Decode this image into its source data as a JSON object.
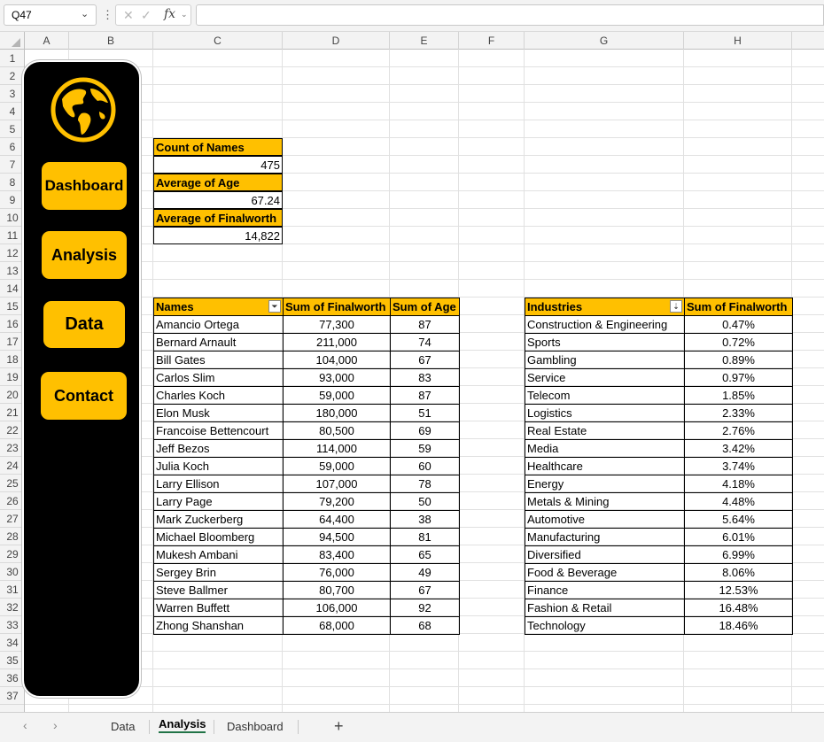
{
  "formula_bar": {
    "name_box": "Q47",
    "formula": ""
  },
  "columns": [
    "A",
    "B",
    "C",
    "D",
    "E",
    "F",
    "G",
    "H"
  ],
  "rows": [
    "1",
    "2",
    "3",
    "4",
    "5",
    "6",
    "7",
    "8",
    "9",
    "10",
    "11",
    "12",
    "13",
    "14",
    "15",
    "16",
    "17",
    "18",
    "19",
    "20",
    "21",
    "22",
    "23",
    "24",
    "25",
    "26",
    "27",
    "28",
    "29",
    "30",
    "31",
    "32",
    "33",
    "34",
    "35",
    "36",
    "37"
  ],
  "sidebar": {
    "buttons": [
      "Dashboard",
      "Analysis",
      "Data",
      "Contact"
    ],
    "colors": {
      "background": "#000000",
      "button": "#ffc000"
    }
  },
  "summary": {
    "count_label": "Count of Names",
    "count_value": "475",
    "age_label": "Average of Age",
    "age_value": "67.24",
    "worth_label": "Average of Finalworth",
    "worth_value": "14,822"
  },
  "people_table": {
    "headers": [
      "Names",
      "Sum of Finalworth",
      "Sum of Age"
    ],
    "rows": [
      [
        "Amancio Ortega",
        "77,300",
        "87"
      ],
      [
        "Bernard Arnault",
        "211,000",
        "74"
      ],
      [
        "Bill Gates",
        "104,000",
        "67"
      ],
      [
        "Carlos Slim",
        "93,000",
        "83"
      ],
      [
        "Charles Koch",
        "59,000",
        "87"
      ],
      [
        "Elon Musk",
        "180,000",
        "51"
      ],
      [
        "Francoise Bettencourt",
        "80,500",
        "69"
      ],
      [
        "Jeff Bezos",
        "114,000",
        "59"
      ],
      [
        "Julia Koch",
        "59,000",
        "60"
      ],
      [
        "Larry Ellison",
        "107,000",
        "78"
      ],
      [
        "Larry Page",
        "79,200",
        "50"
      ],
      [
        "Mark Zuckerberg",
        "64,400",
        "38"
      ],
      [
        "Michael Bloomberg",
        "94,500",
        "81"
      ],
      [
        "Mukesh Ambani",
        "83,400",
        "65"
      ],
      [
        "Sergey Brin",
        "76,000",
        "49"
      ],
      [
        "Steve Ballmer",
        "80,700",
        "67"
      ],
      [
        "Warren Buffett",
        "106,000",
        "92"
      ],
      [
        "Zhong Shanshan",
        "68,000",
        "68"
      ]
    ]
  },
  "industry_table": {
    "headers": [
      "Industries",
      "Sum of Finalworth"
    ],
    "rows": [
      [
        "Construction & Engineering",
        "0.47%"
      ],
      [
        "Sports",
        "0.72%"
      ],
      [
        "Gambling",
        "0.89%"
      ],
      [
        "Service",
        "0.97%"
      ],
      [
        "Telecom",
        "1.85%"
      ],
      [
        "Logistics",
        "2.33%"
      ],
      [
        "Real Estate",
        "2.76%"
      ],
      [
        "Media",
        "3.42%"
      ],
      [
        "Healthcare",
        "3.74%"
      ],
      [
        "Energy",
        "4.18%"
      ],
      [
        "Metals & Mining",
        "4.48%"
      ],
      [
        "Automotive",
        "5.64%"
      ],
      [
        "Manufacturing",
        "6.01%"
      ],
      [
        "Diversified",
        "6.99%"
      ],
      [
        "Food & Beverage",
        "8.06%"
      ],
      [
        "Finance",
        "12.53%"
      ],
      [
        "Fashion & Retail",
        "16.48%"
      ],
      [
        "Technology",
        "18.46%"
      ]
    ]
  },
  "sheet_tabs": {
    "tabs": [
      "Data",
      "Analysis",
      "Dashboard"
    ],
    "active": "Analysis",
    "add_label": "+",
    "prev_icon": "‹",
    "next_icon": "›"
  }
}
